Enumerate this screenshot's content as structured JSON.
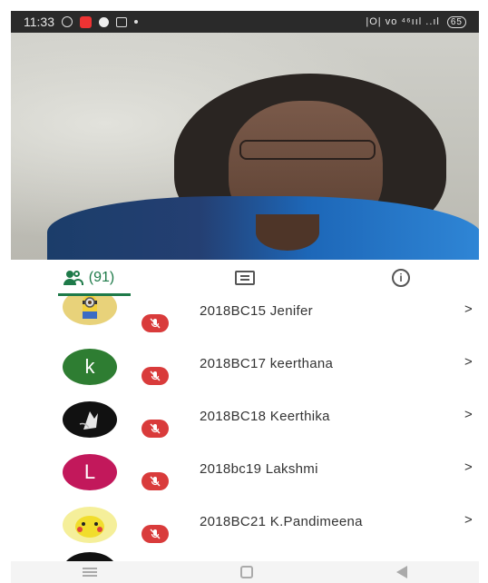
{
  "status_bar": {
    "time": "11:33",
    "right_text": "|O| ᴠᴏ ⁴⁶ııl ..ıl",
    "battery": "65"
  },
  "tabs": {
    "people_count": "(91)"
  },
  "participants": [
    {
      "name": "2018BC15 Jenifer",
      "avatar_type": "image",
      "avatar_color": "#e8d27a",
      "chevron": ">"
    },
    {
      "name": "2018BC17 keerthana",
      "avatar_type": "letter",
      "avatar_letter": "k",
      "avatar_color": "#2e7d32",
      "chevron": ">"
    },
    {
      "name": "2018BC18 Keerthika",
      "avatar_type": "image",
      "avatar_color": "#111111",
      "chevron": ">"
    },
    {
      "name": "2018bc19 Lakshmi",
      "avatar_type": "letter",
      "avatar_letter": "L",
      "avatar_color": "#c2185b",
      "chevron": ">"
    },
    {
      "name": "2018BC21 K.Pandimeena",
      "avatar_type": "image",
      "avatar_color": "#e8dc3a",
      "chevron": ">"
    }
  ],
  "colors": {
    "accent": "#1e7a49",
    "mute_badge": "#d93b3b"
  }
}
